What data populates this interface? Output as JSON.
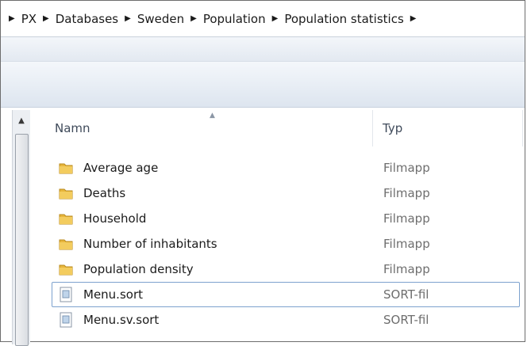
{
  "breadcrumb": [
    "PX",
    "Databases",
    "Sweden",
    "Population",
    "Population statistics"
  ],
  "columns": {
    "name": "Namn",
    "type": "Typ"
  },
  "items": [
    {
      "name": "Average age",
      "type": "Filmapp",
      "icon": "folder-icon"
    },
    {
      "name": "Deaths",
      "type": "Filmapp",
      "icon": "folder-icon"
    },
    {
      "name": "Household",
      "type": "Filmapp",
      "icon": "folder-icon"
    },
    {
      "name": "Number of inhabitants",
      "type": "Filmapp",
      "icon": "folder-icon"
    },
    {
      "name": "Population density",
      "type": "Filmapp",
      "icon": "folder-icon"
    },
    {
      "name": "Menu.sort",
      "type": "SORT-fil",
      "icon": "file-icon",
      "focused": true
    },
    {
      "name": "Menu.sv.sort",
      "type": "SORT-fil",
      "icon": "file-icon"
    }
  ],
  "colors": {
    "folder": "#e8b63c",
    "focus_border": "#7da2ce",
    "type_text": "#6e6e6e"
  }
}
